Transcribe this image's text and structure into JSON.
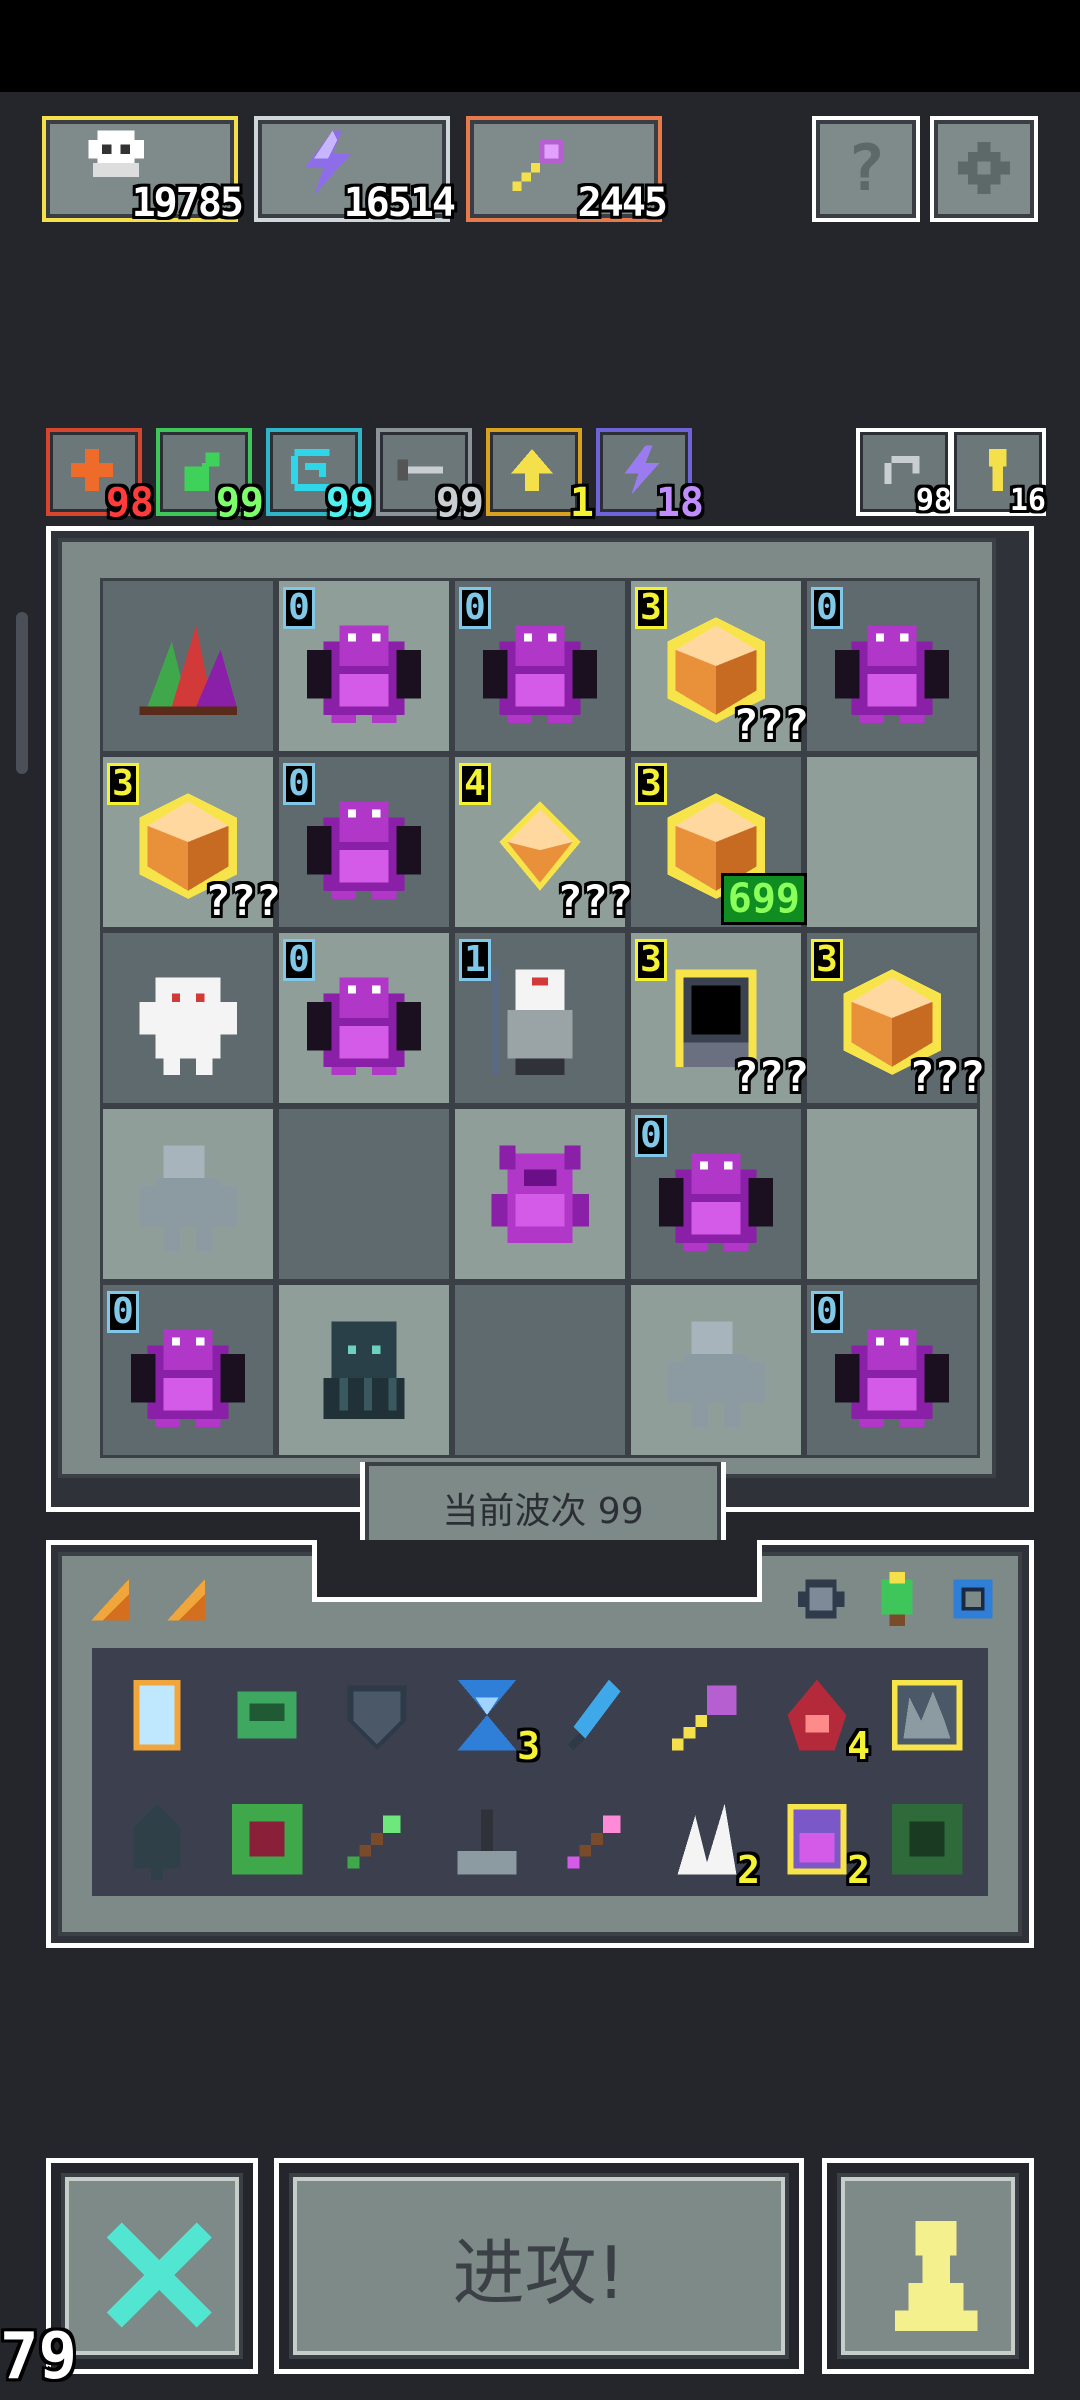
{
  "resources": [
    {
      "name": "skull",
      "value": "19785",
      "color": "#f3e04a",
      "icon": "skull-icon"
    },
    {
      "name": "lightning",
      "value": "16514",
      "color": "#cfd6da",
      "icon": "lightning-icon"
    },
    {
      "name": "staff",
      "value": "2445",
      "color": "#e8794b",
      "icon": "staff-icon"
    }
  ],
  "top_buttons": {
    "help_label": "?",
    "settings_icon": "gear-icon"
  },
  "buffs": [
    {
      "icon": "plus-icon",
      "count": "98",
      "color": "#d8452f",
      "count_color": "#ff3b3b"
    },
    {
      "icon": "orb-icon",
      "count": "99",
      "color": "#3ec65a",
      "count_color": "#7cff6b"
    },
    {
      "icon": "swirl-icon",
      "count": "99",
      "color": "#2fb5c7",
      "count_color": "#4ff0f0"
    },
    {
      "icon": "sword-icon",
      "count": "99",
      "color": "#8c949a",
      "count_color": "#c9ced2"
    },
    {
      "icon": "arrow-up-icon",
      "count": "1",
      "color": "#d8a220",
      "count_color": "#f4f232"
    },
    {
      "icon": "bolt-icon",
      "count": "18",
      "color": "#6e63d8",
      "count_color": "#c08cff"
    }
  ],
  "right_counters": [
    {
      "icon": "return-icon",
      "count": "98"
    },
    {
      "icon": "key-icon",
      "count": "16"
    }
  ],
  "board": [
    [
      {
        "type": "crystal"
      },
      {
        "type": "dragon",
        "level": "0"
      },
      {
        "type": "dragon",
        "level": "0"
      },
      {
        "type": "gem",
        "level": "3",
        "hp": "???"
      },
      {
        "type": "dragon",
        "level": "0"
      }
    ],
    [
      {
        "type": "gem",
        "level": "3",
        "hp": "???"
      },
      {
        "type": "dragon",
        "level": "0"
      },
      {
        "type": "gem-small",
        "level": "4",
        "hp": "???"
      },
      {
        "type": "gem",
        "level": "3",
        "hp": "699",
        "hp_green": true
      },
      {
        "type": "empty"
      }
    ],
    [
      {
        "type": "ghost"
      },
      {
        "type": "dragon",
        "level": "0"
      },
      {
        "type": "shaman",
        "level": "1"
      },
      {
        "type": "portal",
        "level": "3",
        "hp": "???"
      },
      {
        "type": "gem",
        "level": "3",
        "hp": "???"
      }
    ],
    [
      {
        "type": "golem"
      },
      {
        "type": "empty"
      },
      {
        "type": "demon"
      },
      {
        "type": "dragon",
        "level": "0"
      },
      {
        "type": "empty"
      }
    ],
    [
      {
        "type": "dragon",
        "level": "0"
      },
      {
        "type": "cthulhu"
      },
      {
        "type": "empty"
      },
      {
        "type": "golem"
      },
      {
        "type": "dragon",
        "level": "0"
      }
    ]
  ],
  "wave_label": "当前波次 99",
  "inventory": {
    "tab_icons": [
      "shard-icon",
      "shard-icon"
    ],
    "equip_icons": [
      "robot-icon",
      "tree-icon",
      "gear-ring-icon"
    ],
    "row1": [
      {
        "icon": "mirror-icon"
      },
      {
        "icon": "helmet-icon"
      },
      {
        "icon": "shield-icon"
      },
      {
        "icon": "hourglass-icon",
        "count": "3"
      },
      {
        "icon": "feather-icon"
      },
      {
        "icon": "staff-icon"
      },
      {
        "icon": "potion-icon",
        "count": "4"
      },
      {
        "icon": "crown-icon"
      }
    ],
    "row2": [
      {
        "icon": "bell-icon"
      },
      {
        "icon": "vine-icon"
      },
      {
        "icon": "arrow-green-icon"
      },
      {
        "icon": "lever-icon"
      },
      {
        "icon": "arrow-pink-icon"
      },
      {
        "icon": "fang-icon",
        "count": "2"
      },
      {
        "icon": "jar-icon",
        "count": "2"
      },
      {
        "icon": "moss-icon"
      }
    ]
  },
  "actions": {
    "cancel_icon": "x-icon",
    "attack_label": "进攻!",
    "pawn_icon": "pawn-icon"
  },
  "fps": "79"
}
